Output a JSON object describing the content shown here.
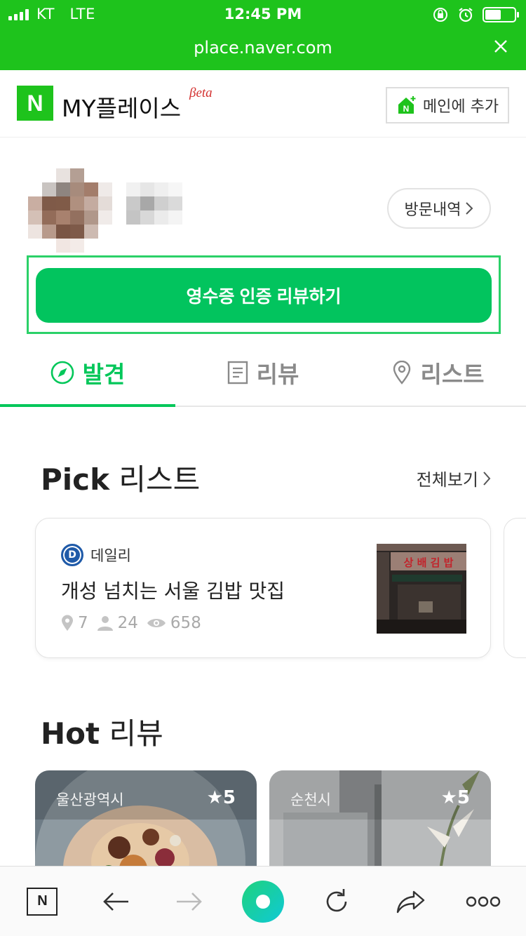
{
  "status_bar": {
    "carrier": "KT",
    "network": "LTE",
    "time": "12:45 PM"
  },
  "browser": {
    "url": "place.naver.com"
  },
  "header": {
    "logo_letter": "N",
    "title": "MY플레이스",
    "beta": "βeta",
    "add_main_label": "메인에 추가"
  },
  "profile": {
    "visit_history_label": "방문내역"
  },
  "review_button_label": "영수증 인증 리뷰하기",
  "tabs": [
    {
      "label": "발견",
      "icon": "compass-icon",
      "active": true
    },
    {
      "label": "리뷰",
      "icon": "document-icon",
      "active": false
    },
    {
      "label": "리스트",
      "icon": "location-pin-icon",
      "active": false
    }
  ],
  "pick": {
    "title_bold": "Pick",
    "title_rest": " 리스트",
    "see_all": "전체보기",
    "card": {
      "source": "데일리",
      "source_logo": "D",
      "title": "개성 넘치는 서울 김밥 맛집",
      "places": "7",
      "followers": "24",
      "views": "658",
      "thumb_sign": "상 배 김 밥"
    }
  },
  "hot": {
    "title_bold": "Hot",
    "title_rest": " 리뷰",
    "cards": [
      {
        "region": "울산광역시",
        "score": "★5"
      },
      {
        "region": "순천시",
        "score": "★5"
      }
    ]
  },
  "colors": {
    "naver_green": "#1ec31c",
    "accent": "#03c75a"
  }
}
